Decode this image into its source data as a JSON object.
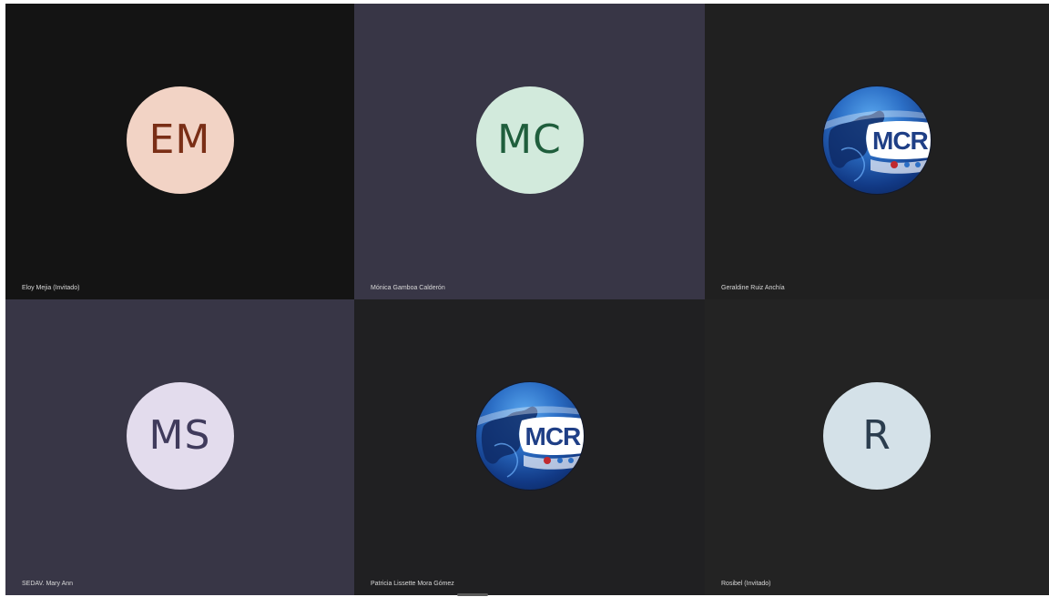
{
  "participants": [
    {
      "name": "Eloy Mejia (Invitado)",
      "initials": "EM",
      "tile_bg": "#141414",
      "avatar_bg": "#f2d3c5",
      "avatar_fg": "#7a2e16"
    },
    {
      "name": "Mónica Gamboa Calderón",
      "initials": "MC",
      "tile_bg": "#383646",
      "avatar_bg": "#d2eadc",
      "avatar_fg": "#1f5e3c"
    },
    {
      "name": "Geraldine Ruiz Anchía",
      "avatar_type": "mcr-logo-icon",
      "logo_text": "MCR",
      "tile_bg": "#202020"
    },
    {
      "name": "SEDAV. Mary Ann",
      "initials": "MS",
      "tile_bg": "#383646",
      "avatar_bg": "#e3dced",
      "avatar_fg": "#403b5c"
    },
    {
      "name": "Patricia Lissette Mora Gómez",
      "avatar_type": "mcr-logo-icon",
      "logo_text": "MCR",
      "tile_bg": "#202022"
    },
    {
      "name": "Rosibel (Invitado)",
      "initials": "R",
      "tile_bg": "#232323",
      "avatar_bg": "#d4e1e8",
      "avatar_fg": "#2b3d4e"
    }
  ]
}
